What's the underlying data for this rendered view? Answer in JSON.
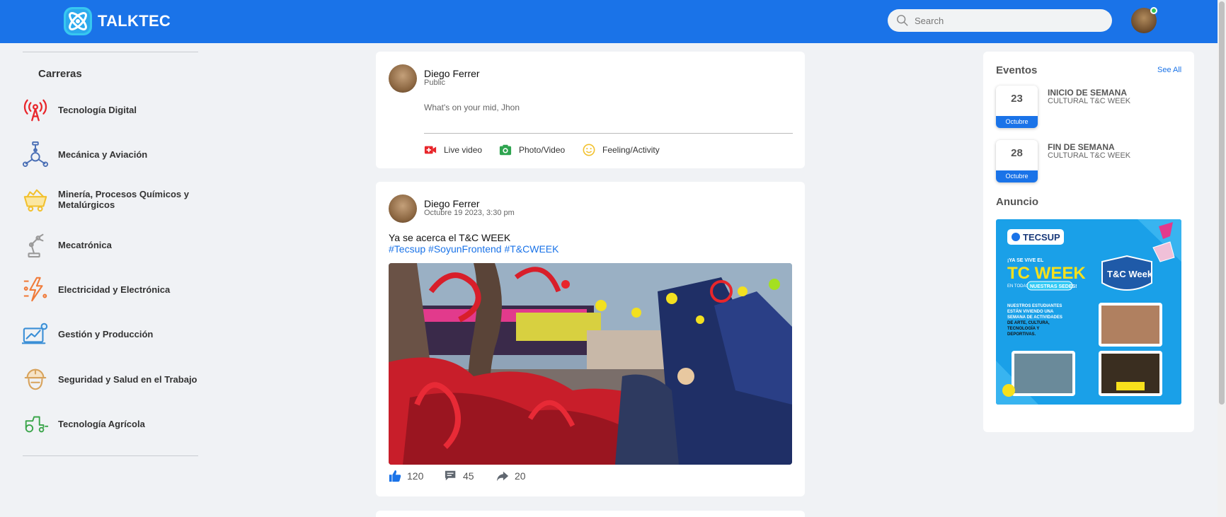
{
  "app": {
    "name": "TALKTEC"
  },
  "search": {
    "placeholder": "Search"
  },
  "sidebar": {
    "title": "Carreras",
    "items": [
      {
        "label": "Tecnología Digital",
        "icon": "radio-tower-icon",
        "color": "#e8262b"
      },
      {
        "label": "Mecánica y Aviación",
        "icon": "mechanical-icon",
        "color": "#4a6fb5"
      },
      {
        "label": "Minería, Procesos Químicos y Metalúrgicos",
        "icon": "mining-cart-icon",
        "color": "#f2c12e"
      },
      {
        "label": "Mecatrónica",
        "icon": "robot-arm-icon",
        "color": "#9a9a9a"
      },
      {
        "label": "Electricidad y Electrónica",
        "icon": "electricity-icon",
        "color": "#f07b3a"
      },
      {
        "label": "Gestión y Producción",
        "icon": "growth-chart-icon",
        "color": "#3b8fd6"
      },
      {
        "label": "Seguridad y Salud en el Trabajo",
        "icon": "safety-helmet-icon",
        "color": "#d8a35c"
      },
      {
        "label": "Tecnología Agrícola",
        "icon": "tractor-icon",
        "color": "#3aa54a"
      }
    ]
  },
  "composer": {
    "user": "Diego Ferrer",
    "visibility": "Public",
    "placeholder": "What's on your mid, Jhon",
    "actions": [
      {
        "label": "Live video",
        "icon": "live-video-icon",
        "color": "#e8262b"
      },
      {
        "label": "Photo/Video",
        "icon": "photo-icon",
        "color": "#2ea44f"
      },
      {
        "label": "Feeling/Activity",
        "icon": "smiley-icon",
        "color": "#f2c12e"
      }
    ]
  },
  "post": {
    "user": "Diego Ferrer",
    "date": "Octubre 19 2023, 3:30 pm",
    "text": "Ya se acerca el T&C WEEK",
    "hashtags": [
      "#Tecsup",
      "#SoyunFrontend",
      "#T&CWEEK"
    ],
    "likes": "120",
    "comments": "45",
    "shares": "20"
  },
  "events": {
    "title": "Eventos",
    "see_all": "See All",
    "items": [
      {
        "day": "23",
        "month": "Octubre",
        "name": "INICIO DE SEMANA",
        "sub": "CULTURAL T&C WEEK"
      },
      {
        "day": "28",
        "month": "Octubre",
        "name": "FIN DE SEMANA",
        "sub": "CULTURAL T&C WEEK"
      }
    ]
  },
  "ad": {
    "title": "Anuncio",
    "brand": "TECSUP",
    "kicker": "¡YA SE VIVE EL",
    "headline": "TC WEEK",
    "tag_pre": "EN TODAS",
    "tag": "NUESTRAS SEDES!",
    "badge": "T&C Week",
    "body": [
      "NUESTROS ESTUDIANTES",
      "ESTÁN VIVIENDO UNA",
      "SEMANA DE ACTIVIDADES",
      "DE ARTE, CULTURA,",
      "TECNOLOGÍA Y",
      "DEPORTIVAS."
    ]
  },
  "colors": {
    "primary": "#1a73e8",
    "background": "#f0f2f5",
    "online": "#31c455"
  }
}
